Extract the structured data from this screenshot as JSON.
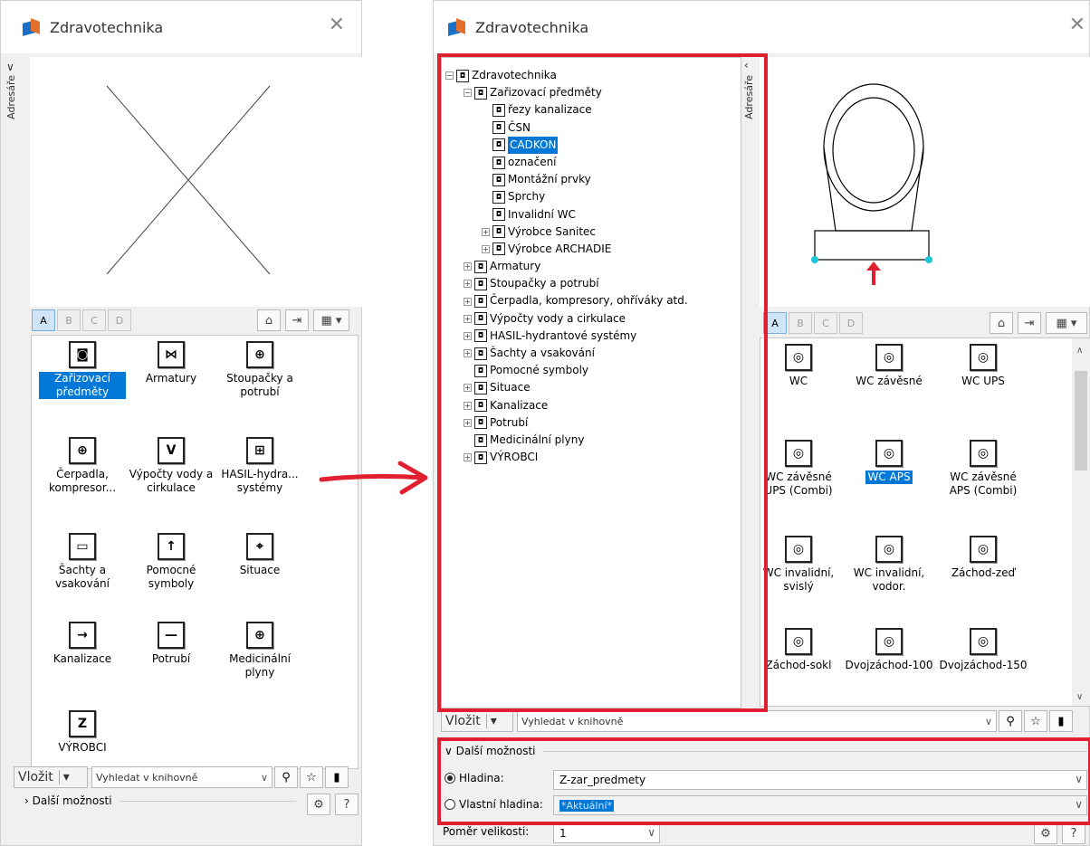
{
  "left_window": {
    "title": "Zdravotechnika",
    "side_tab": "Adresáře",
    "tabs": [
      "A",
      "B",
      "C",
      "D"
    ],
    "grid": [
      {
        "label": "Zařizovací předměty",
        "icon": "toilet-icon",
        "glyph": "◙",
        "selected": true
      },
      {
        "label": "Armatury",
        "icon": "valve-icon",
        "glyph": "⋈",
        "selected": false
      },
      {
        "label": "Stoupačky a potrubí",
        "icon": "riser-icon",
        "glyph": "⊕",
        "selected": false
      },
      {
        "label": "Čerpadla, kompresor...",
        "icon": "pump-icon",
        "glyph": "⊕",
        "selected": false
      },
      {
        "label": "Výpočty vody a cirkulace",
        "icon": "calc-icon",
        "glyph": "V",
        "selected": false
      },
      {
        "label": "HASIL-hydra... systémy",
        "icon": "hydrant-icon",
        "glyph": "⊞",
        "selected": false
      },
      {
        "label": "Šachty a vsakování",
        "icon": "shaft-icon",
        "glyph": "▭",
        "selected": false
      },
      {
        "label": "Pomocné symboly",
        "icon": "arrow-up-icon",
        "glyph": "↑",
        "selected": false
      },
      {
        "label": "Situace",
        "icon": "situation-icon",
        "glyph": "⌖",
        "selected": false
      },
      {
        "label": "Kanalizace",
        "icon": "sewer-icon",
        "glyph": "→",
        "selected": false
      },
      {
        "label": "Potrubí",
        "icon": "pipe-icon",
        "glyph": "—",
        "selected": false
      },
      {
        "label": "Medicinální plyny",
        "icon": "medical-gas-icon",
        "glyph": "⊕",
        "selected": false
      },
      {
        "label": "VÝROBCI",
        "icon": "manufacturers-icon",
        "glyph": "Z",
        "selected": false
      }
    ],
    "insert_label": "Vložit",
    "search_placeholder": "Vyhledat v knihovně",
    "more_options": "Další možnosti"
  },
  "right_window": {
    "title": "Zdravotechnika",
    "side_tab": "Adresáře",
    "tree": [
      {
        "label": "Zdravotechnika",
        "level": 0,
        "pm": "−",
        "selected": false
      },
      {
        "label": "Zařizovací předměty",
        "level": 1,
        "pm": "−",
        "selected": false
      },
      {
        "label": "řezy kanalizace",
        "level": 2,
        "pm": "",
        "selected": false
      },
      {
        "label": "ČSN",
        "level": 2,
        "pm": "",
        "selected": false
      },
      {
        "label": "CADKON",
        "level": 2,
        "pm": "",
        "selected": true
      },
      {
        "label": "označení",
        "level": 2,
        "pm": "",
        "selected": false
      },
      {
        "label": "Montážní prvky",
        "level": 2,
        "pm": "",
        "selected": false
      },
      {
        "label": "Sprchy",
        "level": 2,
        "pm": "",
        "selected": false
      },
      {
        "label": "Invalidní WC",
        "level": 2,
        "pm": "",
        "selected": false
      },
      {
        "label": "Výrobce Sanitec",
        "level": 2,
        "pm": "+",
        "selected": false
      },
      {
        "label": "Výrobce ARCHADIE",
        "level": 2,
        "pm": "+",
        "selected": false
      },
      {
        "label": "Armatury",
        "level": 1,
        "pm": "+",
        "selected": false
      },
      {
        "label": "Stoupačky a potrubí",
        "level": 1,
        "pm": "+",
        "selected": false
      },
      {
        "label": "Čerpadla, kompresory, ohříváky atd.",
        "level": 1,
        "pm": "+",
        "selected": false
      },
      {
        "label": "Výpočty vody a cirkulace",
        "level": 1,
        "pm": "+",
        "selected": false
      },
      {
        "label": "HASIL-hydrantové systémy",
        "level": 1,
        "pm": "+",
        "selected": false
      },
      {
        "label": "Šachty a vsakování",
        "level": 1,
        "pm": "+",
        "selected": false
      },
      {
        "label": "Pomocné symboly",
        "level": 1,
        "pm": "",
        "selected": false
      },
      {
        "label": "Situace",
        "level": 1,
        "pm": "+",
        "selected": false
      },
      {
        "label": "Kanalizace",
        "level": 1,
        "pm": "+",
        "selected": false
      },
      {
        "label": "Potrubí",
        "level": 1,
        "pm": "+",
        "selected": false
      },
      {
        "label": "Medicinální plyny",
        "level": 1,
        "pm": "",
        "selected": false
      },
      {
        "label": "VÝROBCI",
        "level": 1,
        "pm": "+",
        "selected": false
      }
    ],
    "tabs": [
      "A",
      "B",
      "C",
      "D"
    ],
    "grid": [
      {
        "label": "WC",
        "selected": false
      },
      {
        "label": "WC závěsné",
        "selected": false
      },
      {
        "label": "WC UPS",
        "selected": false
      },
      {
        "label": "WC závěsné UPS (Combi)",
        "selected": false
      },
      {
        "label": "WC APS",
        "selected": true
      },
      {
        "label": "WC závěsné APS (Combi)",
        "selected": false
      },
      {
        "label": "WC invalidní, svislý",
        "selected": false
      },
      {
        "label": "WC invalidní, vodor.",
        "selected": false
      },
      {
        "label": "Záchod-zeď",
        "selected": false
      },
      {
        "label": "Záchod-sokl",
        "selected": false
      },
      {
        "label": "Dvojzáchod-100",
        "selected": false
      },
      {
        "label": "Dvojzáchod-150",
        "selected": false
      }
    ],
    "insert_label": "Vložit",
    "search_placeholder": "Vyhledat v knihovně",
    "more_options": "Další možnosti",
    "layer_label": "Hladina:",
    "layer_value": "Z-zar_predmety",
    "own_layer_label": "Vlastní hladina:",
    "own_layer_value": "*Aktuální*",
    "scale_label": "Poměr velikosti:",
    "scale_value": "1"
  },
  "colors": {
    "highlight": "#e02030",
    "selection": "#0078d7",
    "arrow": "#e02030"
  }
}
